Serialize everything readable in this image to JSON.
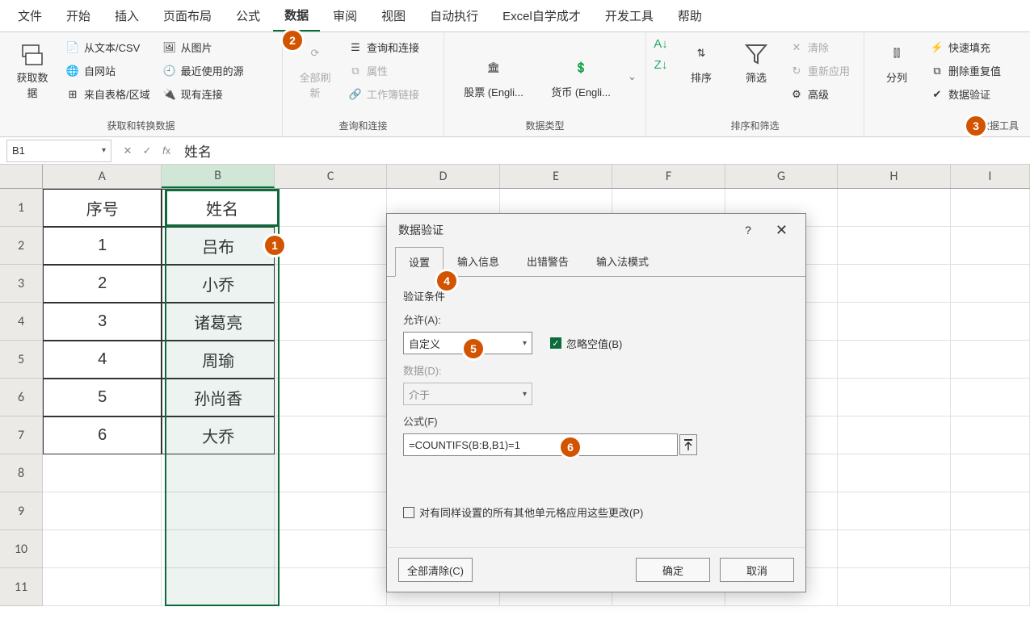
{
  "menu": [
    "文件",
    "开始",
    "插入",
    "页面布局",
    "公式",
    "数据",
    "审阅",
    "视图",
    "自动执行",
    "Excel自学成才",
    "开发工具",
    "帮助"
  ],
  "active_menu": 5,
  "ribbon": {
    "group1": {
      "big": "获取数据",
      "items": [
        "从文本/CSV",
        "自网站",
        "来自表格/区域",
        "从图片",
        "最近使用的源",
        "现有连接"
      ],
      "label": "获取和转换数据"
    },
    "group2": {
      "big": "全部刷新",
      "items": [
        "查询和连接",
        "属性",
        "工作簿链接"
      ],
      "label": "查询和连接"
    },
    "group3": {
      "items": [
        "股票 (Engli...",
        "货币 (Engli..."
      ],
      "label": "数据类型"
    },
    "group4": {
      "big": "排序",
      "big2": "筛选",
      "items": [
        "清除",
        "重新应用",
        "高级"
      ],
      "label": "排序和筛选"
    },
    "group5": {
      "big": "分列",
      "items": [
        "快速填充",
        "删除重复值",
        "数据验证"
      ],
      "label": "数据工具"
    }
  },
  "name_box": "B1",
  "formula_value": "姓名",
  "columns": [
    "A",
    "B",
    "C",
    "D",
    "E",
    "F",
    "G",
    "H",
    "I"
  ],
  "rows": [
    1,
    2,
    3,
    4,
    5,
    6,
    7,
    8,
    9,
    10,
    11
  ],
  "data": {
    "A1": "序号",
    "B1": "姓名",
    "A2": "1",
    "B2": "吕布",
    "A3": "2",
    "B3": "小乔",
    "A4": "3",
    "B4": "诸葛亮",
    "A5": "4",
    "B5": "周瑜",
    "A6": "5",
    "B6": "孙尚香",
    "A7": "6",
    "B7": "大乔"
  },
  "dialog": {
    "title": "数据验证",
    "help": "?",
    "tabs": [
      "设置",
      "输入信息",
      "出错警告",
      "输入法模式"
    ],
    "active_tab": 0,
    "section": "验证条件",
    "allow_label": "允许(A):",
    "allow_value": "自定义",
    "ignore_blank": "忽略空值(B)",
    "data_label": "数据(D):",
    "data_value": "介于",
    "formula_label": "公式(F)",
    "formula_value": "=COUNTIFS(B:B,B1)=1",
    "apply_label": "对有同样设置的所有其他单元格应用这些更改(P)",
    "clear": "全部清除(C)",
    "ok": "确定",
    "cancel": "取消"
  },
  "badges": [
    "1",
    "2",
    "3",
    "4",
    "5",
    "6"
  ]
}
